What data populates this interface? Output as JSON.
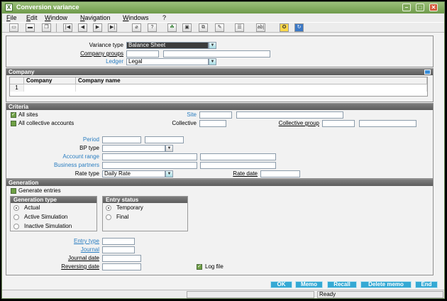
{
  "window": {
    "title": "Conversion variance"
  },
  "menu": [
    "File",
    "Edit",
    "Window",
    "Navigation",
    "Windows",
    "?"
  ],
  "toolbar": {
    "icons": [
      "save-icon",
      "print-icon",
      "copy-icon",
      "first-record-icon",
      "previous-record-icon",
      "next-record-icon",
      "last-record-icon",
      "attach-icon",
      "help-icon",
      "tree-icon",
      "window-icon",
      "windows-icon",
      "edit-icon",
      "list-icon",
      "text-icon",
      "info-icon",
      "refresh-icon"
    ],
    "text_button": "ab|"
  },
  "header_section": {
    "variance_type_label": "Variance type",
    "variance_type_value": "Balance Sheet",
    "company_groups_label": "Company groups",
    "ledger_label": "Ledger",
    "ledger_value": "Legal"
  },
  "company": {
    "title": "Company",
    "columns": [
      "Company",
      "Company name"
    ],
    "row_numbers": [
      "1"
    ]
  },
  "criteria": {
    "title": "Criteria",
    "all_sites_label": "All sites",
    "all_collective_label": "All collective accounts",
    "site_label": "Site",
    "collective_label": "Collective",
    "collective_group_label": "Collective group",
    "period_label": "Period",
    "bp_type_label": "BP type",
    "account_range_label": "Account range",
    "business_partners_label": "Business partners",
    "rate_type_label": "Rate type",
    "rate_type_value": "Daily Rate",
    "rate_date_label": "Rate date"
  },
  "generation": {
    "title": "Generation",
    "generate_entries_label": "Generate entries",
    "generation_type": {
      "title": "Generation type",
      "options": [
        "Actual",
        "Active Simulation",
        "Inactive Simulation"
      ],
      "selected": "Actual"
    },
    "entry_status": {
      "title": "Entry status",
      "options": [
        "Temporary",
        "Final"
      ],
      "selected": "Temporary"
    },
    "entry_type_label": "Entry type",
    "journal_label": "Journal",
    "journal_date_label": "Journal date",
    "reversing_date_label": "Reversing date",
    "log_file_label": "Log file"
  },
  "actions": [
    "OK",
    "Memo",
    "Recall",
    "Delete memo",
    "End"
  ],
  "status_bar": {
    "status": "Ready"
  },
  "colors": {
    "title_bar": "#7ea85a",
    "section_header": "#6a6a6a",
    "action_button": "#35a9d4",
    "link": "#2b7ec1"
  }
}
